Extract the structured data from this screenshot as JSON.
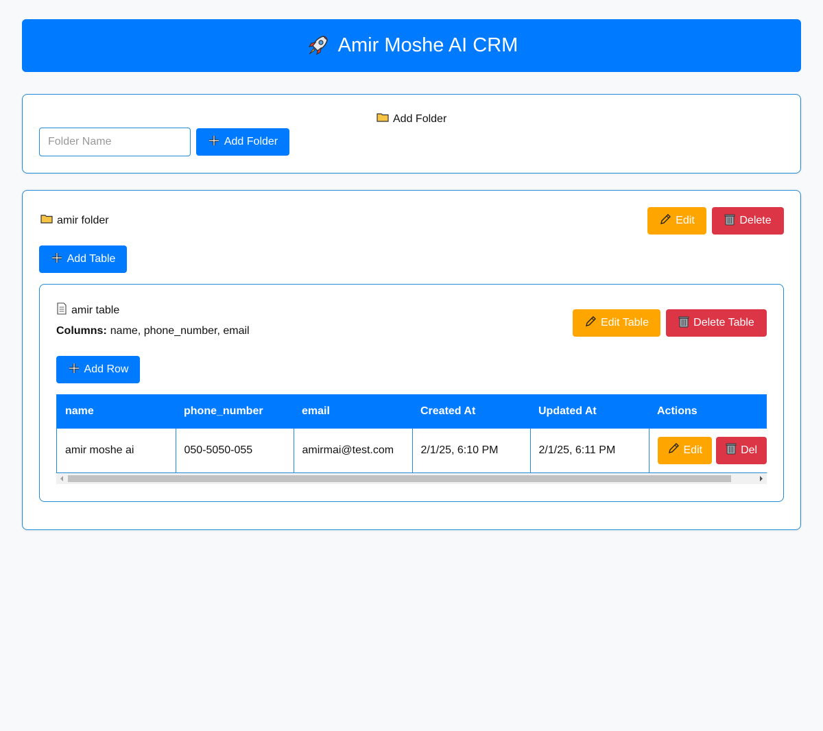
{
  "header": {
    "title": "Amir Moshe AI CRM",
    "icon": "rocket-icon"
  },
  "add_folder_section": {
    "heading": "Add Folder",
    "input_placeholder": "Folder Name",
    "input_value": "",
    "button_label": "Add Folder"
  },
  "folder": {
    "name": "amir folder",
    "edit_label": "Edit",
    "delete_label": "Delete",
    "add_table_label": "Add Table",
    "table": {
      "name": "amir table",
      "columns_label": "Columns:",
      "columns_value": "name, phone_number, email",
      "edit_label": "Edit Table",
      "delete_label": "Delete Table",
      "add_row_label": "Add Row",
      "headers": [
        "name",
        "phone_number",
        "email",
        "Created At",
        "Updated At",
        "Actions"
      ],
      "rows": [
        {
          "name": "amir moshe ai",
          "phone_number": "050-5050-055",
          "email": "amirmai@test.com",
          "created_at": "2/1/25, 6:10 PM",
          "updated_at": "2/1/25, 6:11 PM",
          "edit_label": "Edit",
          "delete_label": "Del"
        }
      ]
    }
  },
  "colors": {
    "primary": "#007bff",
    "warning": "#ffa500",
    "danger": "#dc3545",
    "border": "#1f8ad6",
    "background": "#f7f9fb"
  }
}
